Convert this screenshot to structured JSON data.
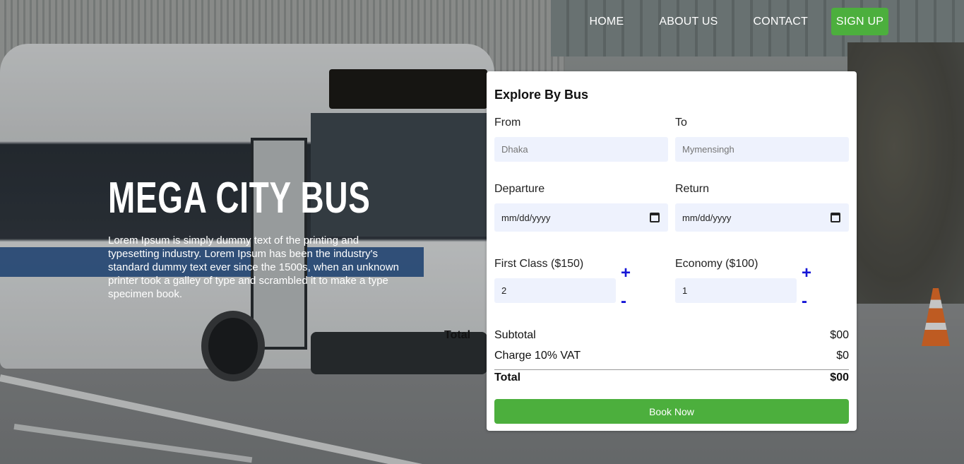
{
  "nav": {
    "items": [
      "HOME",
      "ABOUT US",
      "CONTACT"
    ],
    "signup_label": "SIGN UP"
  },
  "hero": {
    "title": "MEGA CITY BUS",
    "description": "Lorem Ipsum is simply dummy text of the printing and typesetting industry. Lorem Ipsum has been the industry's standard dummy text ever since the 1500s, when an unknown printer took a galley of type and scrambled it to make a type specimen book.",
    "ghost_total": "Total"
  },
  "booking": {
    "title": "Explore By Bus",
    "from_label": "From",
    "from_placeholder": "Dhaka",
    "to_label": "To",
    "to_placeholder": "Mymensingh",
    "departure_label": "Departure",
    "departure_value": "mm/dd/yyyy",
    "return_label": "Return",
    "return_value": "mm/dd/yyyy",
    "first_class_label": "First Class ($150)",
    "first_class_qty": "2",
    "economy_label": "Economy ($100)",
    "economy_qty": "1",
    "plus": "+",
    "minus": "-",
    "subtotal_label": "Subtotal",
    "subtotal_value": "$00",
    "vat_label": "Charge 10% VAT",
    "vat_value": "$0",
    "total_label": "Total",
    "total_value": "$00",
    "book_label": "Book Now"
  },
  "colors": {
    "accent_green": "#4caf3d",
    "input_bg": "#eef2fd",
    "stepper_blue": "#1515d6"
  }
}
